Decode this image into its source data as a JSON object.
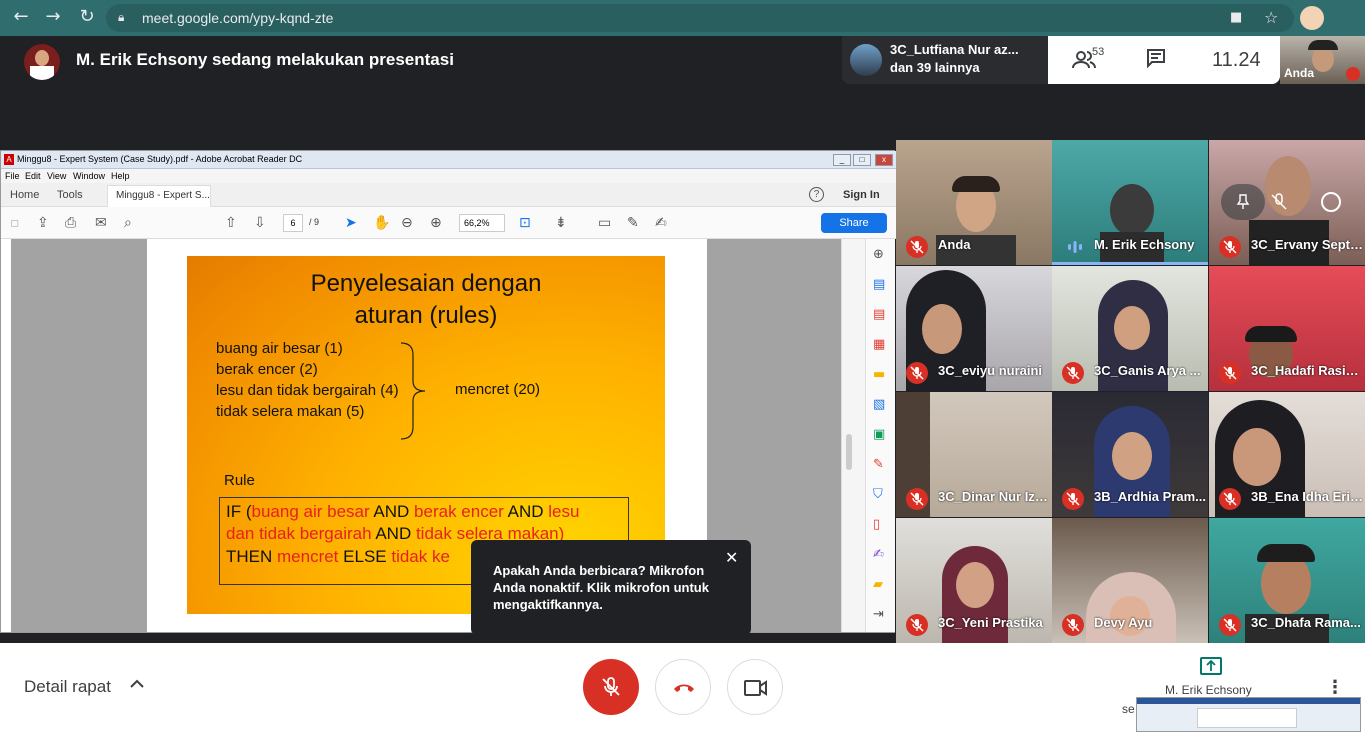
{
  "browser": {
    "url": "meet.google.com/ypy-kqnd-zte"
  },
  "meet": {
    "presenter_text": "M. Erik Echsony sedang melakukan presentasi",
    "chip_line1": "3C_Lutfiana Nur az...",
    "chip_line2": "dan 39 lainnya",
    "people_count": "53",
    "clock": "11.24",
    "self_label": "Anda"
  },
  "acrobat": {
    "window_title": "Minggu8 - Expert System (Case Study).pdf - Adobe Acrobat Reader DC",
    "menu": [
      "File",
      "Edit",
      "View",
      "Window",
      "Help"
    ],
    "tab_home": "Home",
    "tab_tools": "Tools",
    "tab_doc": "Minggu8 - Expert S...",
    "sign_in": "Sign In",
    "page_current": "6",
    "page_total": "/ 9",
    "zoom": "66,2%",
    "share": "Share"
  },
  "slide": {
    "title_line1": "Penyelesaian dengan",
    "title_line2": "aturan (rules)",
    "conditions": [
      "buang air besar (1)",
      "berak encer (2)",
      "lesu dan tidak bergairah (4)",
      "tidak selera makan (5)"
    ],
    "result": "mencret (20)",
    "rule_label": "Rule",
    "rule": {
      "l1_a": "IF (",
      "l1_b": "buang air besar",
      "l1_c": " AND ",
      "l1_d": "berak encer",
      "l1_e": " AND ",
      "l1_f": "lesu",
      "l2_a": "dan tidak bergairah",
      "l2_b": " AND ",
      "l2_c": "tidak selera makan)",
      "l3_a": "THEN ",
      "l3_b": "mencret",
      "l3_c": " ELSE ",
      "l3_d": "tidak ke"
    }
  },
  "tooltip": {
    "text": "Apakah Anda berbicara? Mikrofon Anda nonaktif. Klik mikrofon untuk mengaktifkannya.",
    "close": "✕"
  },
  "participants": [
    {
      "name": "Anda"
    },
    {
      "name": "M. Erik Echsony"
    },
    {
      "name": "3C_Ervany Septa..."
    },
    {
      "name": "3C_eviyu nuraini"
    },
    {
      "name": "3C_Ganis Arya ..."
    },
    {
      "name": "3C_Hadafi Rasis..."
    },
    {
      "name": "3C_Dinar Nur Izz..."
    },
    {
      "name": "3B_Ardhia Pram..."
    },
    {
      "name": "3B_Ena Idha Eris..."
    },
    {
      "name": "3C_Yeni Prastika"
    },
    {
      "name": "Devy Ayu"
    },
    {
      "name": "3C_Dhafa Rama..."
    }
  ],
  "bottom": {
    "details": "Detail rapat",
    "present_label": "M. Erik Echsony",
    "present_sub": "se"
  },
  "colors": {
    "browser_bar": "#2f6d6e",
    "mic_off_red": "#d93025",
    "share_blue": "#1473e6",
    "slide_red_text": "#e8201c",
    "speaking_teal": "#00796b"
  },
  "icons": [
    "back-arrow-icon",
    "forward-arrow-icon",
    "reload-icon",
    "lock-icon",
    "camera-icon",
    "star-icon",
    "profile-icon",
    "people-icon",
    "chat-icon",
    "mic-off-icon",
    "hang-up-icon",
    "video-camera-icon",
    "present-icon",
    "more-vert-icon",
    "chevron-up-icon",
    "close-icon"
  ]
}
